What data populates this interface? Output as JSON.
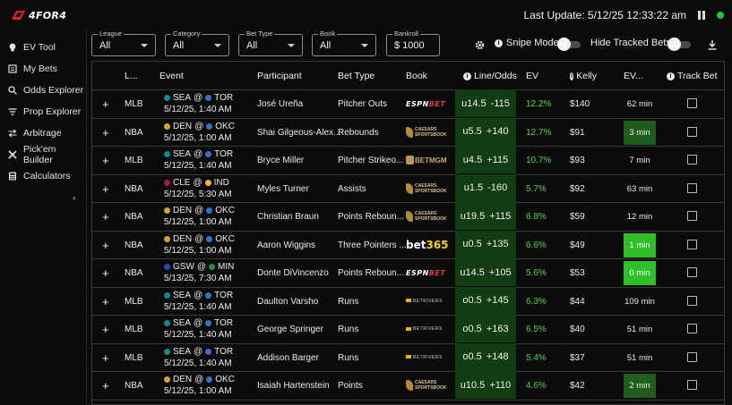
{
  "app": {
    "logo_text": "4FOR4"
  },
  "header": {
    "last_update_label": "Last Update:",
    "last_update_value": "5/12/25 12:33:22 am"
  },
  "sidebar": {
    "items": [
      {
        "label": "EV Tool",
        "icon": "lightbulb-icon"
      },
      {
        "label": "My Bets",
        "icon": "receipt-icon"
      },
      {
        "label": "Odds Explorer",
        "icon": "search-icon"
      },
      {
        "label": "Prop Explorer",
        "icon": "filter-icon"
      },
      {
        "label": "Arbitrage",
        "icon": "arbitrage-arrows-icon"
      },
      {
        "label": "Pick'em Builder",
        "icon": "tools-icon"
      },
      {
        "label": "Calculators",
        "icon": "calculator-icon"
      }
    ],
    "collapse_glyph": "‹"
  },
  "filters": {
    "league": {
      "label": "League",
      "value": "All"
    },
    "category": {
      "label": "Category",
      "value": "All"
    },
    "bet_type": {
      "label": "Bet Type",
      "value": "All"
    },
    "book": {
      "label": "Book",
      "value": "All"
    },
    "bankroll": {
      "label": "Bankroll",
      "value": "$ 1000"
    }
  },
  "controls": {
    "snipe_mode": "Snipe Mode",
    "hide_tracked": "Hide Tracked Bets"
  },
  "table": {
    "headers": [
      "L...",
      "Event",
      "Participant",
      "Bet Type",
      "Book",
      "Line/Odds",
      "EV",
      "Kelly",
      "EV...",
      "Track Bet"
    ],
    "rows": [
      {
        "league": "MLB",
        "away": "SEA",
        "home": "TOR",
        "sep": "@",
        "time": "5/12/25, 1:40 AM",
        "participant": "José Ureña",
        "bet_type": "Pitcher Outs",
        "book": "espnbet",
        "line": "u14.5",
        "odds": "-115",
        "ev": "12.2%",
        "kelly": "$140",
        "ev_time": "62 min",
        "ev_time_style": "none"
      },
      {
        "league": "NBA",
        "away": "DEN",
        "home": "OKC",
        "sep": "@",
        "time": "5/12/25, 1:00 AM",
        "participant": "Shai Gilgeous-Alex...",
        "bet_type": "Rebounds",
        "book": "caesars",
        "line": "u5.5",
        "odds": "+140",
        "ev": "12.7%",
        "kelly": "$91",
        "ev_time": "3 min",
        "ev_time_style": "dark"
      },
      {
        "league": "MLB",
        "away": "SEA",
        "home": "TOR",
        "sep": "@",
        "time": "5/12/25, 1:40 AM",
        "participant": "Bryce Miller",
        "bet_type": "Pitcher Strikeo...",
        "book": "betmgm",
        "line": "u4.5",
        "odds": "+115",
        "ev": "10.7%",
        "kelly": "$93",
        "ev_time": "7 min",
        "ev_time_style": "none"
      },
      {
        "league": "NBA",
        "away": "CLE",
        "home": "IND",
        "sep": "@",
        "time": "5/12/25, 5:30 AM",
        "participant": "Myles Turner",
        "bet_type": "Assists",
        "book": "caesars",
        "line": "u1.5",
        "odds": "-160",
        "ev": "5.7%",
        "kelly": "$92",
        "ev_time": "63 min",
        "ev_time_style": "none"
      },
      {
        "league": "NBA",
        "away": "DEN",
        "home": "OKC",
        "sep": "@",
        "time": "5/12/25, 1:00 AM",
        "participant": "Christian Braun",
        "bet_type": "Points Reboun...",
        "book": "caesars",
        "line": "u19.5",
        "odds": "+115",
        "ev": "6.8%",
        "kelly": "$59",
        "ev_time": "12 min",
        "ev_time_style": "none"
      },
      {
        "league": "NBA",
        "away": "DEN",
        "home": "OKC",
        "sep": "@",
        "time": "5/12/25, 1:00 AM",
        "participant": "Aaron Wiggins",
        "bet_type": "Three Pointers ...",
        "book": "bet365",
        "line": "u0.5",
        "odds": "+135",
        "ev": "6.6%",
        "kelly": "$49",
        "ev_time": "1 min",
        "ev_time_style": "bright"
      },
      {
        "league": "NBA",
        "away": "GSW",
        "home": "MIN",
        "sep": "@",
        "time": "5/13/25, 7:30 AM",
        "participant": "Donte DiVincenzo",
        "bet_type": "Points Reboun...",
        "book": "espnbet",
        "line": "u14.5",
        "odds": "+105",
        "ev": "5.6%",
        "kelly": "$53",
        "ev_time": "0 min",
        "ev_time_style": "bright"
      },
      {
        "league": "MLB",
        "away": "SEA",
        "home": "TOR",
        "sep": "@",
        "time": "5/12/25, 1:40 AM",
        "participant": "Daulton Varsho",
        "bet_type": "Runs",
        "book": "betrivers",
        "line": "o0.5",
        "odds": "+145",
        "ev": "6.3%",
        "kelly": "$44",
        "ev_time": "109 min",
        "ev_time_style": "none"
      },
      {
        "league": "MLB",
        "away": "SEA",
        "home": "TOR",
        "sep": "@",
        "time": "5/12/25, 1:40 AM",
        "participant": "George Springer",
        "bet_type": "Runs",
        "book": "betrivers",
        "line": "o0.5",
        "odds": "+163",
        "ev": "6.5%",
        "kelly": "$40",
        "ev_time": "51 min",
        "ev_time_style": "none"
      },
      {
        "league": "MLB",
        "away": "SEA",
        "home": "TOR",
        "sep": "@",
        "time": "5/12/25, 1:40 AM",
        "participant": "Addison Barger",
        "bet_type": "Runs",
        "book": "betrivers",
        "line": "o0.5",
        "odds": "+148",
        "ev": "5.4%",
        "kelly": "$37",
        "ev_time": "51 min",
        "ev_time_style": "none"
      },
      {
        "league": "NBA",
        "away": "DEN",
        "home": "OKC",
        "sep": "@",
        "time": "5/12/25, 1:00 AM",
        "participant": "Isaiah Hartenstein",
        "bet_type": "Points",
        "book": "caesars",
        "line": "u10.5",
        "odds": "+110",
        "ev": "4.6%",
        "kelly": "$42",
        "ev_time": "2 min",
        "ev_time_style": "dark"
      }
    ]
  },
  "books": {
    "espnbet": {
      "a": "ESPN",
      "b": "BET"
    },
    "caesars": {
      "a": "CAESARS",
      "b": "SPORTSBOOK"
    },
    "betmgm": {
      "a": "BETMGM"
    },
    "bet365": {
      "a": "bet",
      "b": "365"
    },
    "betrivers": {
      "a": "BETRIVERS"
    }
  },
  "team_colors": {
    "SEA": "#0c8c8c",
    "TOR": "#3d6fc9",
    "DEN": "#d4a72c",
    "OKC": "#2e74c7",
    "CLE": "#9b2335",
    "IND": "#f1b52b",
    "GSW": "#1d4fb8",
    "MIN": "#2f8a4a"
  },
  "colors": {
    "ev_green": "#58d34f",
    "line_cell": "#123d12",
    "ev_time_dark": "#1f5d1d",
    "ev_time_bright": "#2fbf2a",
    "live": "#29c23b"
  }
}
